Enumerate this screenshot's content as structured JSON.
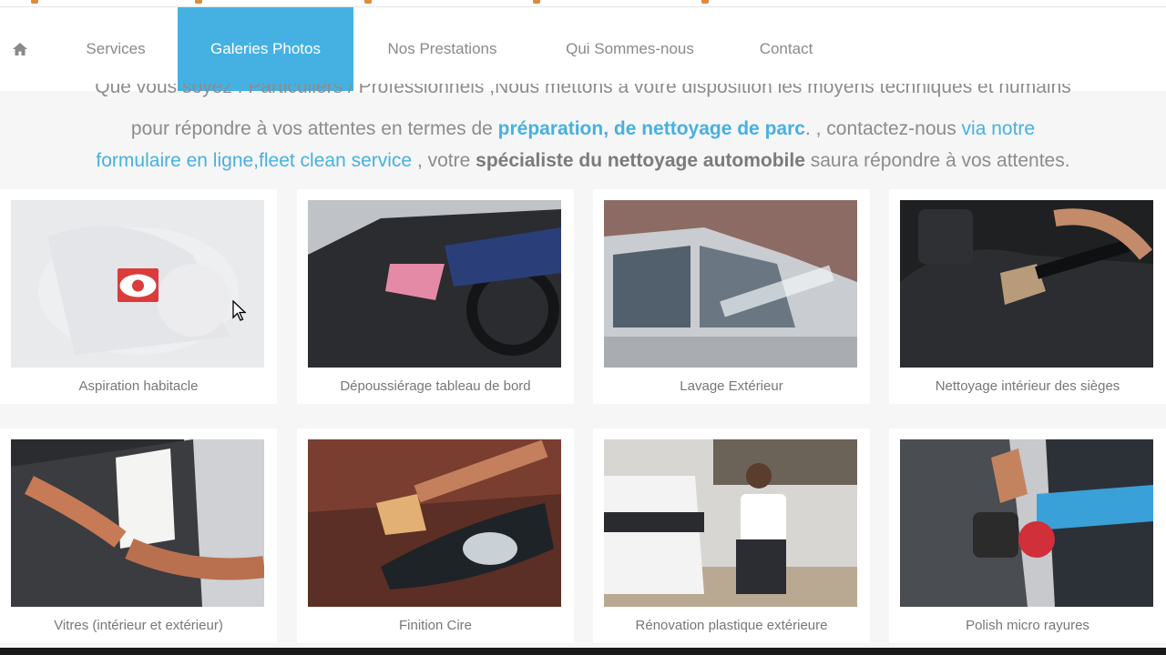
{
  "nav": {
    "home_icon": "home-icon",
    "items": [
      {
        "label": "Services"
      },
      {
        "label": "Galeries Photos",
        "active": true
      },
      {
        "label": "Nos Prestations"
      },
      {
        "label": "Qui Sommes-nous"
      },
      {
        "label": "Contact"
      }
    ],
    "active_color": "#45b1e3"
  },
  "intro": {
    "line1_partial": "Que vous soyez : Particuliers / Professionnels ,Nous mettons à votre disposition les moyens techniques et humains",
    "line2_a": "pour répondre à vos attentes en termes de ",
    "line2_bold_link": "préparation, de nettoyage de parc",
    "line2_b": ". , contactez-nous ",
    "line2_link": "via notre",
    "line3_link": "formulaire en ligne,fleet clean service",
    "line3_a": " , votre ",
    "line3_bold": "spécialiste du nettoyage automobile",
    "line3_b": " saura répondre à vos attentes."
  },
  "gallery": {
    "hover_icon": "eye-icon",
    "items": [
      {
        "caption": "Aspiration habitacle"
      },
      {
        "caption": "Dépoussiérage tableau de bord"
      },
      {
        "caption": "Lavage Extérieur"
      },
      {
        "caption": "Nettoyage intérieur des sièges"
      },
      {
        "caption": "Vitres (intérieur et extérieur)"
      },
      {
        "caption": "Finition Cire"
      },
      {
        "caption": "Rénovation plastique extérieure"
      },
      {
        "caption": "Polish micro rayures"
      }
    ]
  }
}
